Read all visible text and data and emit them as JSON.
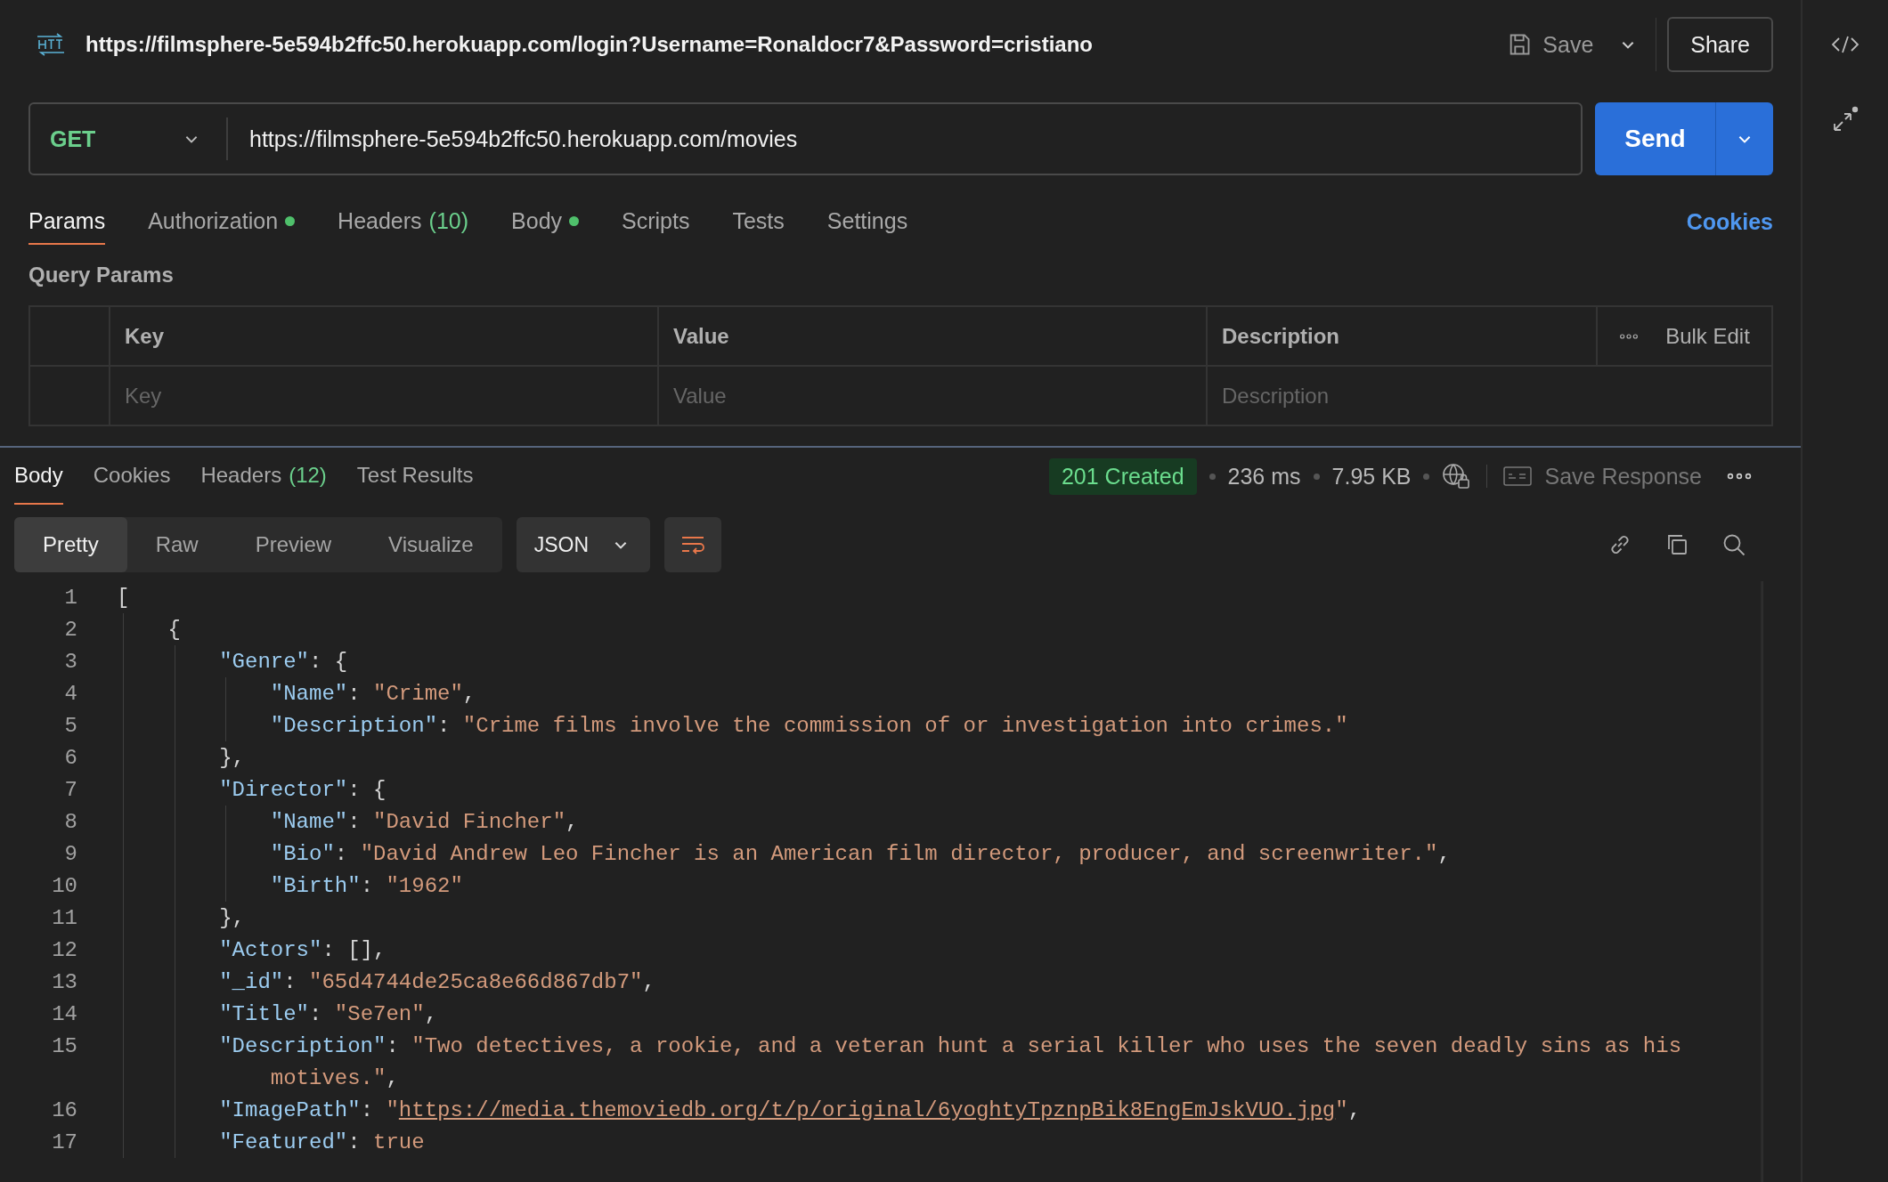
{
  "request": {
    "title": "https://filmsphere-5e594b2ffc50.herokuapp.com/login?Username=Ronaldocr7&Password=cristiano",
    "save_label": "Save",
    "share_label": "Share",
    "method": "GET",
    "url": "https://filmsphere-5e594b2ffc50.herokuapp.com/movies",
    "send_label": "Send",
    "tabs": [
      {
        "label": "Params",
        "selected": true,
        "dot": false
      },
      {
        "label": "Authorization",
        "selected": false,
        "dot": true
      },
      {
        "label": "Headers",
        "count": "(10)",
        "selected": false,
        "dot": false
      },
      {
        "label": "Body",
        "selected": false,
        "dot": true
      },
      {
        "label": "Scripts",
        "selected": false,
        "dot": false
      },
      {
        "label": "Tests",
        "selected": false,
        "dot": false
      },
      {
        "label": "Settings",
        "selected": false,
        "dot": false
      }
    ],
    "cookies_link": "Cookies",
    "query_params": {
      "title": "Query Params",
      "columns": [
        "Key",
        "Value",
        "Description"
      ],
      "bulk_edit": "Bulk Edit",
      "placeholders": [
        "Key",
        "Value",
        "Description"
      ]
    }
  },
  "response": {
    "tabs": [
      {
        "label": "Body",
        "selected": true
      },
      {
        "label": "Cookies",
        "selected": false
      },
      {
        "label": "Headers",
        "count": "(12)",
        "selected": false
      },
      {
        "label": "Test Results",
        "selected": false
      }
    ],
    "status": "201 Created",
    "time": "236 ms",
    "size": "7.95 KB",
    "save_response": "Save Response",
    "views": [
      {
        "label": "Pretty",
        "selected": true
      },
      {
        "label": "Raw",
        "selected": false
      },
      {
        "label": "Preview",
        "selected": false
      },
      {
        "label": "Visualize",
        "selected": false
      }
    ],
    "format": "JSON",
    "lines": [
      {
        "number": "1",
        "tokens": [
          {
            "kind": "punct",
            "text": "["
          }
        ],
        "children": [
          {
            "number": "2",
            "tokens": [
              {
                "kind": "punct",
                "text": "{"
              }
            ],
            "children": [
              {
                "number": "3",
                "tokens": [
                  {
                    "kind": "key",
                    "text": "\"Genre\""
                  },
                  {
                    "kind": "punct",
                    "text": ": {"
                  }
                ],
                "children": [
                  {
                    "number": "4",
                    "tokens": [
                      {
                        "kind": "key",
                        "text": "\"Name\""
                      },
                      {
                        "kind": "punct",
                        "text": ": "
                      },
                      {
                        "kind": "string",
                        "text": "\"Crime\""
                      },
                      {
                        "kind": "punct",
                        "text": ","
                      }
                    ]
                  },
                  {
                    "number": "5",
                    "tokens": [
                      {
                        "kind": "key",
                        "text": "\"Description\""
                      },
                      {
                        "kind": "punct",
                        "text": ": "
                      },
                      {
                        "kind": "string",
                        "text": "\"Crime films involve the commission of or investigation into crimes.\""
                      }
                    ]
                  }
                ]
              },
              {
                "number": "6",
                "tokens": [
                  {
                    "kind": "punct",
                    "text": "},"
                  }
                ]
              },
              {
                "number": "7",
                "tokens": [
                  {
                    "kind": "key",
                    "text": "\"Director\""
                  },
                  {
                    "kind": "punct",
                    "text": ": {"
                  }
                ],
                "children": [
                  {
                    "number": "8",
                    "tokens": [
                      {
                        "kind": "key",
                        "text": "\"Name\""
                      },
                      {
                        "kind": "punct",
                        "text": ": "
                      },
                      {
                        "kind": "string",
                        "text": "\"David Fincher\""
                      },
                      {
                        "kind": "punct",
                        "text": ","
                      }
                    ]
                  },
                  {
                    "number": "9",
                    "tokens": [
                      {
                        "kind": "key",
                        "text": "\"Bio\""
                      },
                      {
                        "kind": "punct",
                        "text": ": "
                      },
                      {
                        "kind": "string",
                        "text": "\"David Andrew Leo Fincher is an American film director, producer, and screenwriter.\""
                      },
                      {
                        "kind": "punct",
                        "text": ","
                      }
                    ]
                  },
                  {
                    "number": "10",
                    "tokens": [
                      {
                        "kind": "key",
                        "text": "\"Birth\""
                      },
                      {
                        "kind": "punct",
                        "text": ": "
                      },
                      {
                        "kind": "string",
                        "text": "\"1962\""
                      }
                    ]
                  }
                ]
              },
              {
                "number": "11",
                "tokens": [
                  {
                    "kind": "punct",
                    "text": "},"
                  }
                ]
              },
              {
                "number": "12",
                "tokens": [
                  {
                    "kind": "key",
                    "text": "\"Actors\""
                  },
                  {
                    "kind": "punct",
                    "text": ": [],"
                  }
                ]
              },
              {
                "number": "13",
                "tokens": [
                  {
                    "kind": "key",
                    "text": "\"_id\""
                  },
                  {
                    "kind": "punct",
                    "text": ": "
                  },
                  {
                    "kind": "string",
                    "text": "\"65d4744de25ca8e66d867db7\""
                  },
                  {
                    "kind": "punct",
                    "text": ","
                  }
                ]
              },
              {
                "number": "14",
                "tokens": [
                  {
                    "kind": "key",
                    "text": "\"Title\""
                  },
                  {
                    "kind": "punct",
                    "text": ": "
                  },
                  {
                    "kind": "string",
                    "text": "\"Se7en\""
                  },
                  {
                    "kind": "punct",
                    "text": ","
                  }
                ]
              },
              {
                "number": "15",
                "tokens": [
                  {
                    "kind": "key",
                    "text": "\"Description\""
                  },
                  {
                    "kind": "punct",
                    "text": ": "
                  },
                  {
                    "kind": "string",
                    "text": "\"Two detectives, a rookie, and a veteran hunt a serial killer who uses the seven deadly sins as his"
                  }
                ],
                "wrap": [
                  {
                    "kind": "string",
                    "text": "motives.\""
                  },
                  {
                    "kind": "punct",
                    "text": ","
                  }
                ]
              },
              {
                "number": "16",
                "tokens": [
                  {
                    "kind": "key",
                    "text": "\"ImagePath\""
                  },
                  {
                    "kind": "punct",
                    "text": ": "
                  },
                  {
                    "kind": "string",
                    "text": "\""
                  },
                  {
                    "kind": "link",
                    "text": "https://media.themoviedb.org/t/p/original/6yoghtyTpznpBik8EngEmJskVUO.jpg"
                  },
                  {
                    "kind": "string",
                    "text": "\""
                  },
                  {
                    "kind": "punct",
                    "text": ","
                  }
                ]
              },
              {
                "number": "17",
                "tokens": [
                  {
                    "kind": "key",
                    "text": "\"Featured\""
                  },
                  {
                    "kind": "punct",
                    "text": ": "
                  },
                  {
                    "kind": "literal",
                    "text": "true"
                  }
                ]
              }
            ]
          }
        ]
      }
    ]
  }
}
